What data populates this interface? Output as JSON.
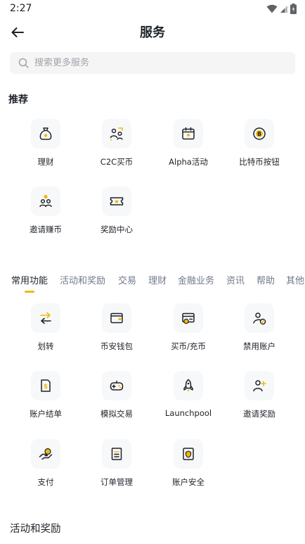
{
  "status_bar": {
    "time": "2:27"
  },
  "header": {
    "title": "服务"
  },
  "search": {
    "placeholder": "搜索更多服务"
  },
  "recommended": {
    "title": "推荐",
    "items": [
      {
        "label": "理财",
        "icon": "money-bag-icon"
      },
      {
        "label": "C2C买币",
        "icon": "users-exchange-icon"
      },
      {
        "label": "Alpha活动",
        "icon": "calendar-icon"
      },
      {
        "label": "比特币按钮",
        "icon": "bitcoin-icon"
      },
      {
        "label": "邀请赚币",
        "icon": "invite-earn-icon"
      },
      {
        "label": "奖励中心",
        "icon": "ticket-icon"
      }
    ]
  },
  "tabs": [
    {
      "label": "常用功能",
      "active": true
    },
    {
      "label": "活动和奖励"
    },
    {
      "label": "交易"
    },
    {
      "label": "理财"
    },
    {
      "label": "金融业务"
    },
    {
      "label": "资讯"
    },
    {
      "label": "帮助"
    },
    {
      "label": "其他"
    }
  ],
  "common": {
    "items": [
      {
        "label": "划转",
        "icon": "transfer-icon"
      },
      {
        "label": "币安钱包",
        "icon": "wallet-icon"
      },
      {
        "label": "买币/充币",
        "icon": "buy-deposit-icon"
      },
      {
        "label": "禁用账户",
        "icon": "disable-account-icon"
      },
      {
        "label": "账户结单",
        "icon": "statement-icon"
      },
      {
        "label": "模拟交易",
        "icon": "gamepad-icon"
      },
      {
        "label": "Launchpool",
        "icon": "rocket-icon"
      },
      {
        "label": "邀请奖励",
        "icon": "invite-reward-icon"
      },
      {
        "label": "支付",
        "icon": "payment-icon"
      },
      {
        "label": "订单管理",
        "icon": "order-list-icon"
      },
      {
        "label": "账户安全",
        "icon": "security-icon"
      }
    ]
  },
  "bottom_section": {
    "title": "活动和奖励"
  },
  "colors": {
    "accent": "#f0b90b",
    "text": "#1e2329",
    "muted": "#707a8a",
    "tile": "#f7f8f9"
  }
}
